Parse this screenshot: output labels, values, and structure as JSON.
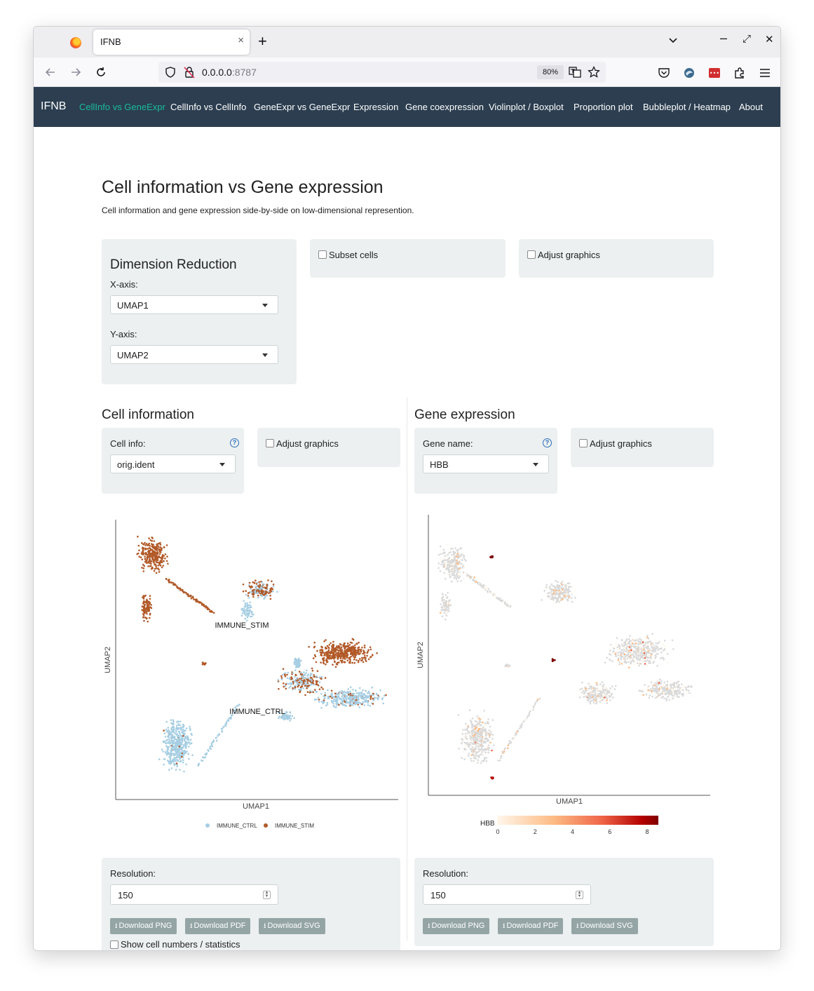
{
  "browser": {
    "tab_title": "IFNB",
    "tab_close": "×",
    "new_tab": "+",
    "url_host": "0.0.0.0",
    "url_port": ":8787",
    "zoom": "80%",
    "win_min": "–",
    "win_max": "⤢",
    "win_close": "✕"
  },
  "navbar": {
    "brand": "IFNB",
    "links": [
      "CellInfo vs GeneExpr",
      "CellInfo vs CellInfo",
      "GeneExpr vs GeneExpr",
      "Expression",
      "Gene coexpression",
      "Violinplot / Boxplot",
      "Proportion plot",
      "Bubbleplot / Heatmap",
      "About"
    ]
  },
  "page": {
    "title": "Cell information vs Gene expression",
    "subtitle": "Cell information and gene expression side-by-side on low-dimensional represention."
  },
  "dimred": {
    "heading": "Dimension Reduction",
    "x_label": "X-axis:",
    "x_value": "UMAP1",
    "y_label": "Y-axis:",
    "y_value": "UMAP2",
    "subset_label": "Subset cells",
    "adjust_label": "Adjust graphics"
  },
  "cellinfo": {
    "heading": "Cell information",
    "label": "Cell info:",
    "value": "orig.ident",
    "adjust_label": "Adjust graphics",
    "resolution_label": "Resolution:",
    "resolution_value": "150",
    "btn_png": "Download PNG",
    "btn_pdf": "Download PDF",
    "btn_svg": "Download SVG",
    "show_stats_label": "Show cell numbers / statistics"
  },
  "geneexpr": {
    "heading": "Gene expression",
    "label": "Gene name:",
    "value": "HBB",
    "adjust_label": "Adjust graphics",
    "resolution_label": "Resolution:",
    "resolution_value": "150",
    "btn_png": "Download PNG",
    "btn_pdf": "Download PDF",
    "btn_svg": "Download SVG"
  },
  "chart_data": [
    {
      "type": "scatter",
      "xlabel": "UMAP1",
      "ylabel": "UMAP2",
      "annotations": [
        "IMMUNE_STIM",
        "IMMUNE_CTRL"
      ],
      "series": [
        {
          "name": "IMMUNE_CTRL",
          "color": "#a6cee3"
        },
        {
          "name": "IMMUNE_STIM",
          "color": "#b15928"
        }
      ],
      "legend_position": "bottom"
    },
    {
      "type": "scatter",
      "xlabel": "UMAP1",
      "ylabel": "UMAP2",
      "colorbar": {
        "title": "HBB",
        "ticks": [
          "0",
          "2",
          "4",
          "6",
          "8"
        ],
        "colors": [
          "#fff7ec",
          "#fdbb84",
          "#ef6548",
          "#b30000",
          "#7f0000"
        ]
      },
      "legend_position": "bottom"
    }
  ]
}
